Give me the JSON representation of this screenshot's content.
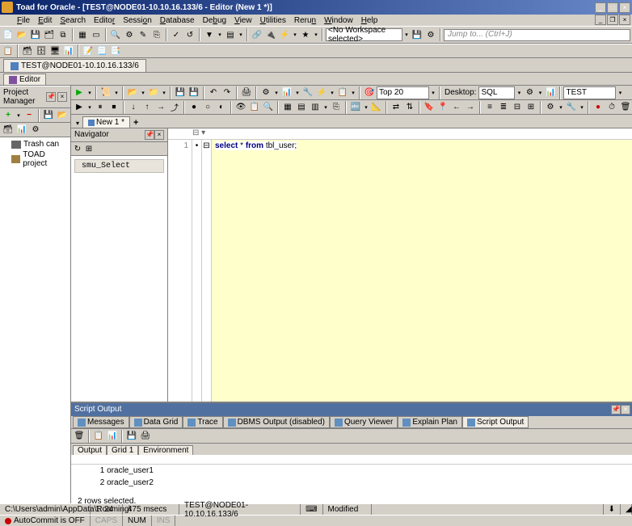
{
  "titlebar": {
    "title": "Toad for Oracle - [TEST@NODE01-10.10.16.133/6 - Editor (New 1 *)]"
  },
  "menubar": {
    "items": [
      "File",
      "Edit",
      "Search",
      "Editor",
      "Session",
      "Database",
      "Debug",
      "View",
      "Utilities",
      "Rerun",
      "Window",
      "Help"
    ]
  },
  "main_toolbar": {
    "workspace_dropdown": "<No Workspace selected>",
    "jump_placeholder": "Jump to... (Ctrl+J)"
  },
  "conn_tab": {
    "label": "TEST@NODE01-10.10.16.133/6"
  },
  "editor_tab": {
    "label": "Editor"
  },
  "project_manager": {
    "title": "Project Manager",
    "items": [
      "Trash can",
      "TOAD project"
    ]
  },
  "sql_toolbar": {
    "limit_dropdown": "Top 20",
    "mode_label": "Desktop:",
    "mode_dropdown": "SQL",
    "schema_dropdown": "TEST"
  },
  "editor": {
    "tab_label": "New 1 *",
    "navigator_title": "Navigator",
    "nav_item": "smu_Select",
    "line_number": "1",
    "sql_select": "select",
    "sql_star": " * ",
    "sql_from": "from",
    "sql_table": " tbl_user;"
  },
  "output": {
    "header": "Script Output",
    "tabs": [
      "Messages",
      "Data Grid",
      "Trace",
      "DBMS Output (disabled)",
      "Query Viewer",
      "Explain Plan",
      "Script Output"
    ],
    "subtabs": [
      "Output",
      "Grid 1",
      "Environment"
    ],
    "result_lines": [
      "          1 oracle_user1",
      "          2 oracle_user2"
    ],
    "summary": "2 rows selected."
  },
  "statusbar": {
    "path": "C:\\Users\\admin\\AppData\\Roaming\\",
    "pos": "1: 24",
    "time": "475 msecs",
    "conn": "TEST@NODE01-10.10.16.133/6",
    "modified": "Modified",
    "autocommit": "AutoCommit is OFF",
    "caps": "CAPS",
    "num": "NUM",
    "ins": "INS"
  }
}
